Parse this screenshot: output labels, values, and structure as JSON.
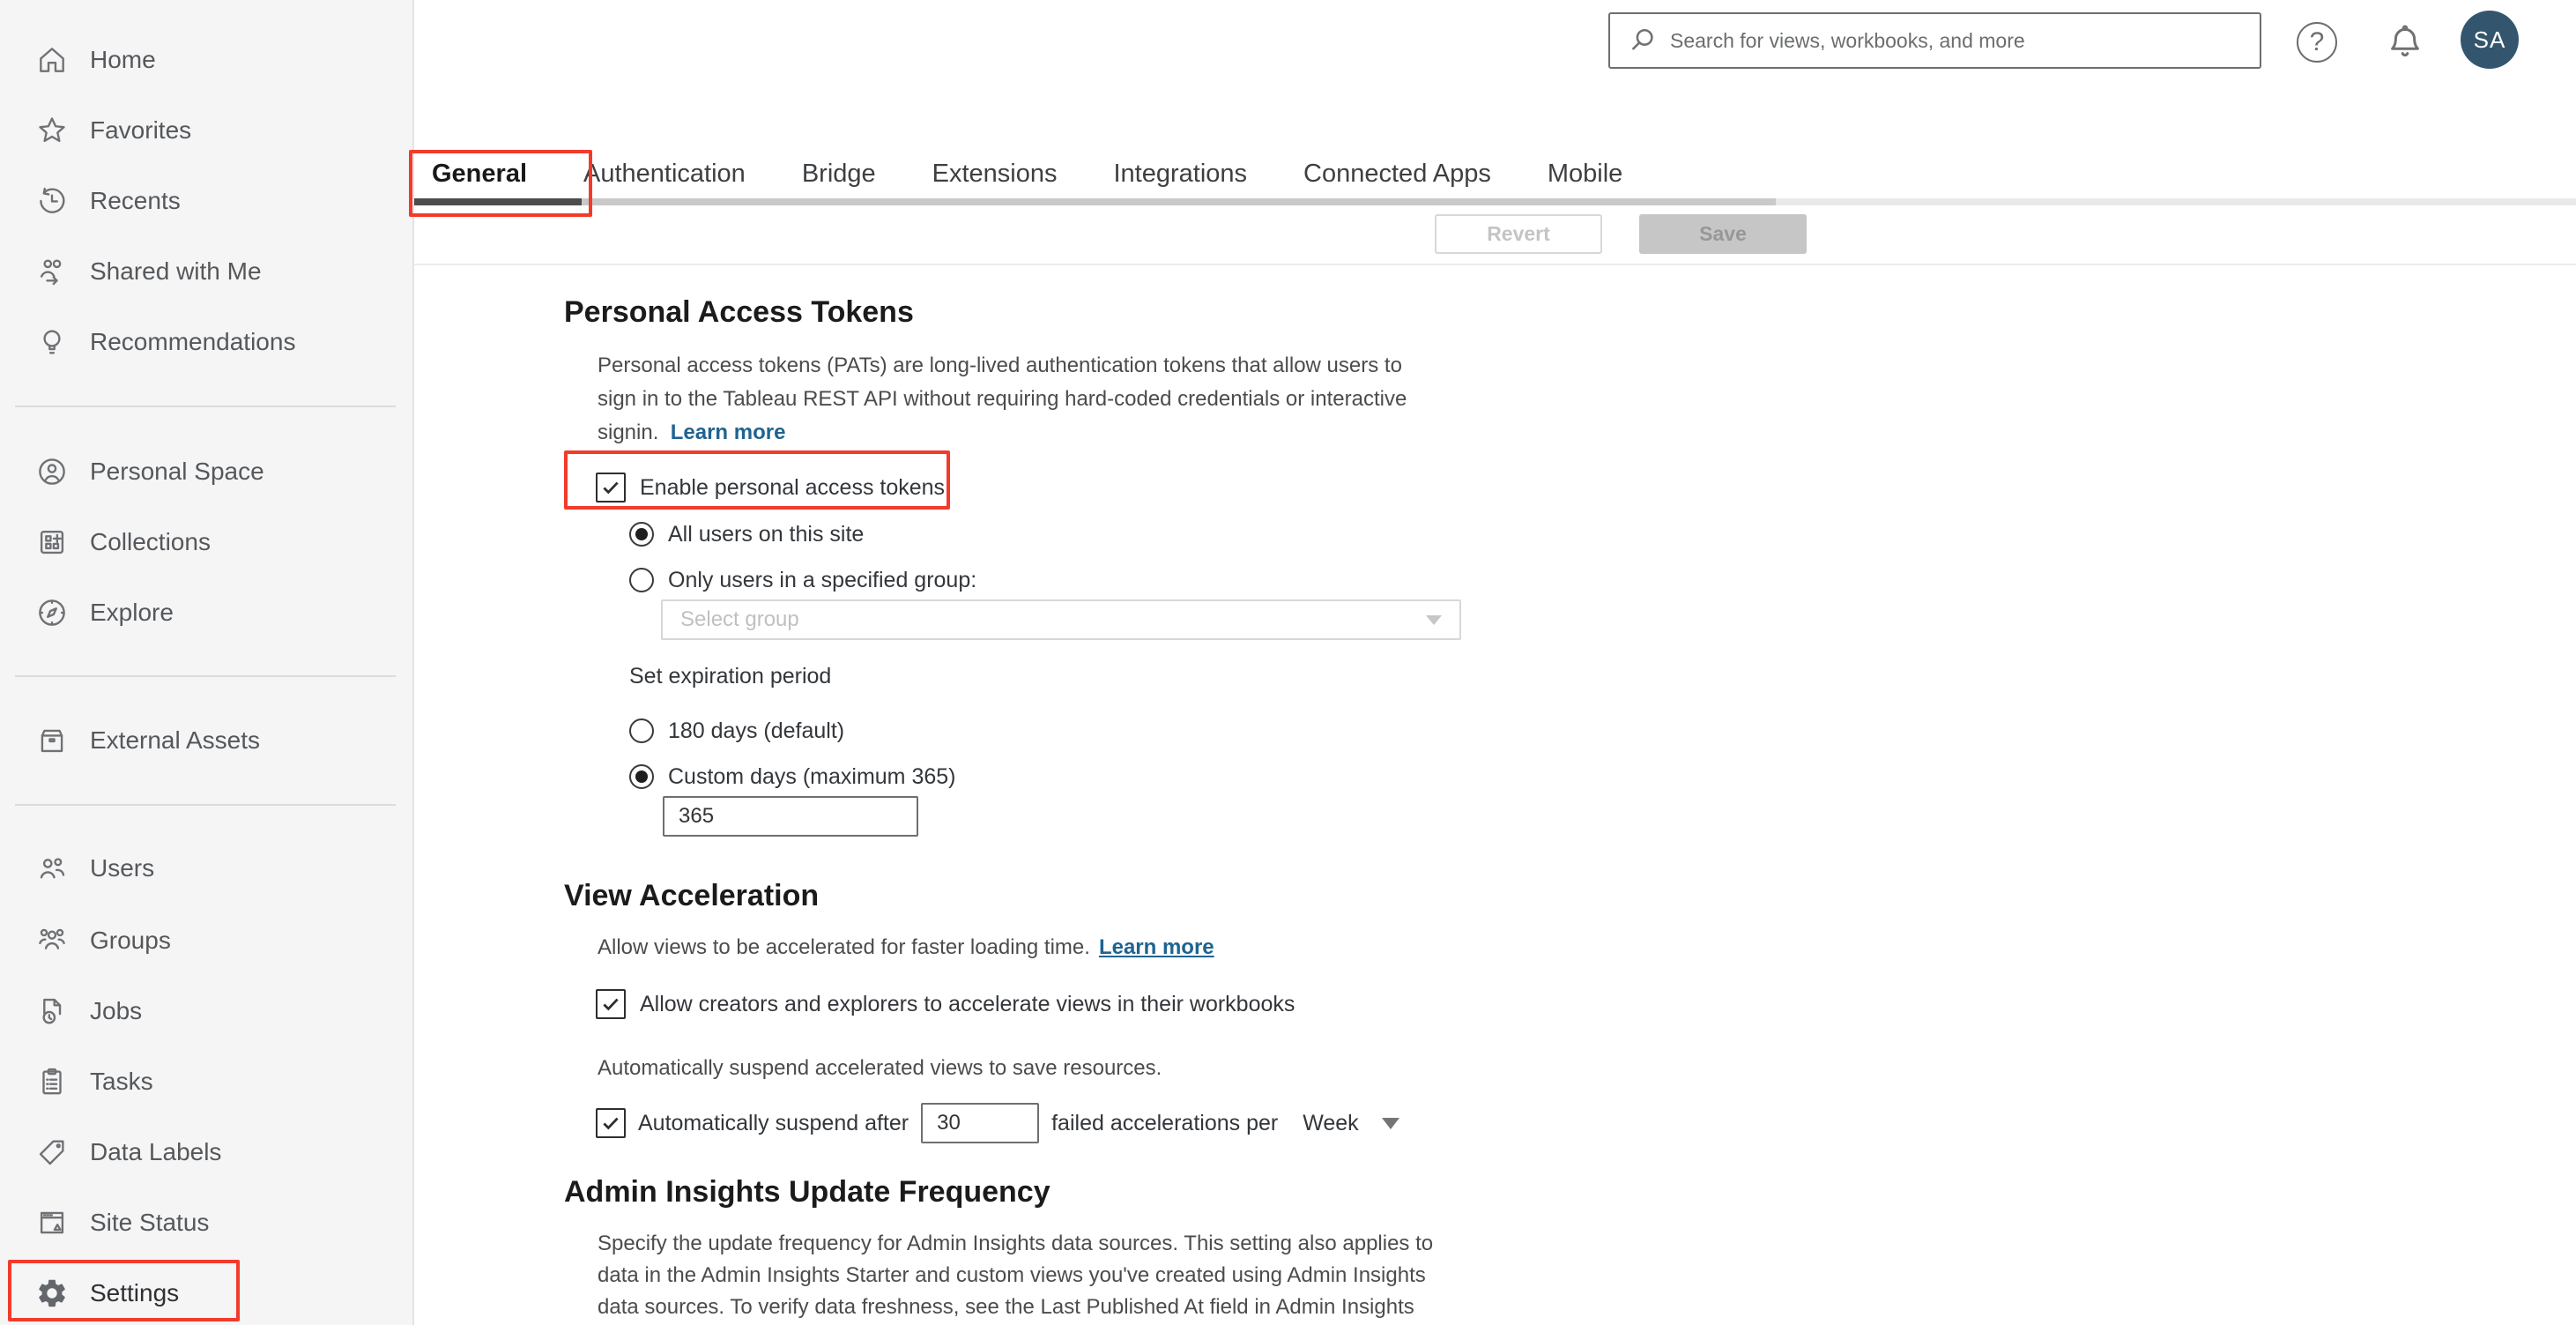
{
  "header": {
    "search_placeholder": "Search for views, workbooks, and more",
    "help_glyph": "?",
    "avatar_initials": "SA"
  },
  "sidebar": {
    "items": [
      {
        "label": "Home"
      },
      {
        "label": "Favorites"
      },
      {
        "label": "Recents"
      },
      {
        "label": "Shared with Me"
      },
      {
        "label": "Recommendations"
      },
      {
        "label": "Personal Space"
      },
      {
        "label": "Collections"
      },
      {
        "label": "Explore"
      },
      {
        "label": "External Assets"
      },
      {
        "label": "Users"
      },
      {
        "label": "Groups"
      },
      {
        "label": "Jobs"
      },
      {
        "label": "Tasks"
      },
      {
        "label": "Data Labels"
      },
      {
        "label": "Site Status"
      },
      {
        "label": "Settings"
      }
    ]
  },
  "tabs": {
    "items": [
      "General",
      "Authentication",
      "Bridge",
      "Extensions",
      "Integrations",
      "Connected Apps",
      "Mobile"
    ],
    "active": "General"
  },
  "toolbar": {
    "revert_label": "Revert",
    "save_label": "Save"
  },
  "sections": {
    "pat": {
      "title": "Personal Access Tokens",
      "description_line1": "Personal access tokens (PATs) are long-lived authentication tokens that allow users to",
      "description_line2": "sign in to the Tableau REST API without requiring hard-coded credentials or interactive",
      "description_line3": "signin.",
      "learn_more": "Learn more",
      "enable_label": "Enable personal access tokens",
      "radio_all_users": "All users on this site",
      "radio_group": "Only users in a specified group:",
      "group_placeholder": "Select group",
      "expiration_label": "Set expiration period",
      "radio_default": "180 days (default)",
      "radio_custom": "Custom days (maximum 365)",
      "custom_days_value": "365"
    },
    "view_acceleration": {
      "title": "View Acceleration",
      "intro": "Allow views to be accelerated for faster loading time.",
      "learn_more": "Learn more",
      "allow_label": "Allow creators and explorers to accelerate views in their workbooks",
      "suspend_intro": "Automatically suspend accelerated views to save resources.",
      "suspend_prefix": "Automatically suspend after",
      "suspend_value": "30",
      "suspend_suffix": "failed accelerations per",
      "suspend_period": "Week"
    },
    "admin_insights": {
      "title": "Admin Insights Update Frequency",
      "description_line1": "Specify the update frequency for Admin Insights data sources. This setting also applies to",
      "description_line2": "data in the Admin Insights Starter and custom views you've created using Admin Insights",
      "description_line3": "data sources. To verify data freshness, see the Last Published At field in Admin Insights"
    }
  },
  "colors": {
    "annotation_red": "#f23b2b",
    "avatar_bg": "#33566e",
    "link_blue": "#1f6391",
    "active_tab_underline": "#4d4d4d"
  }
}
